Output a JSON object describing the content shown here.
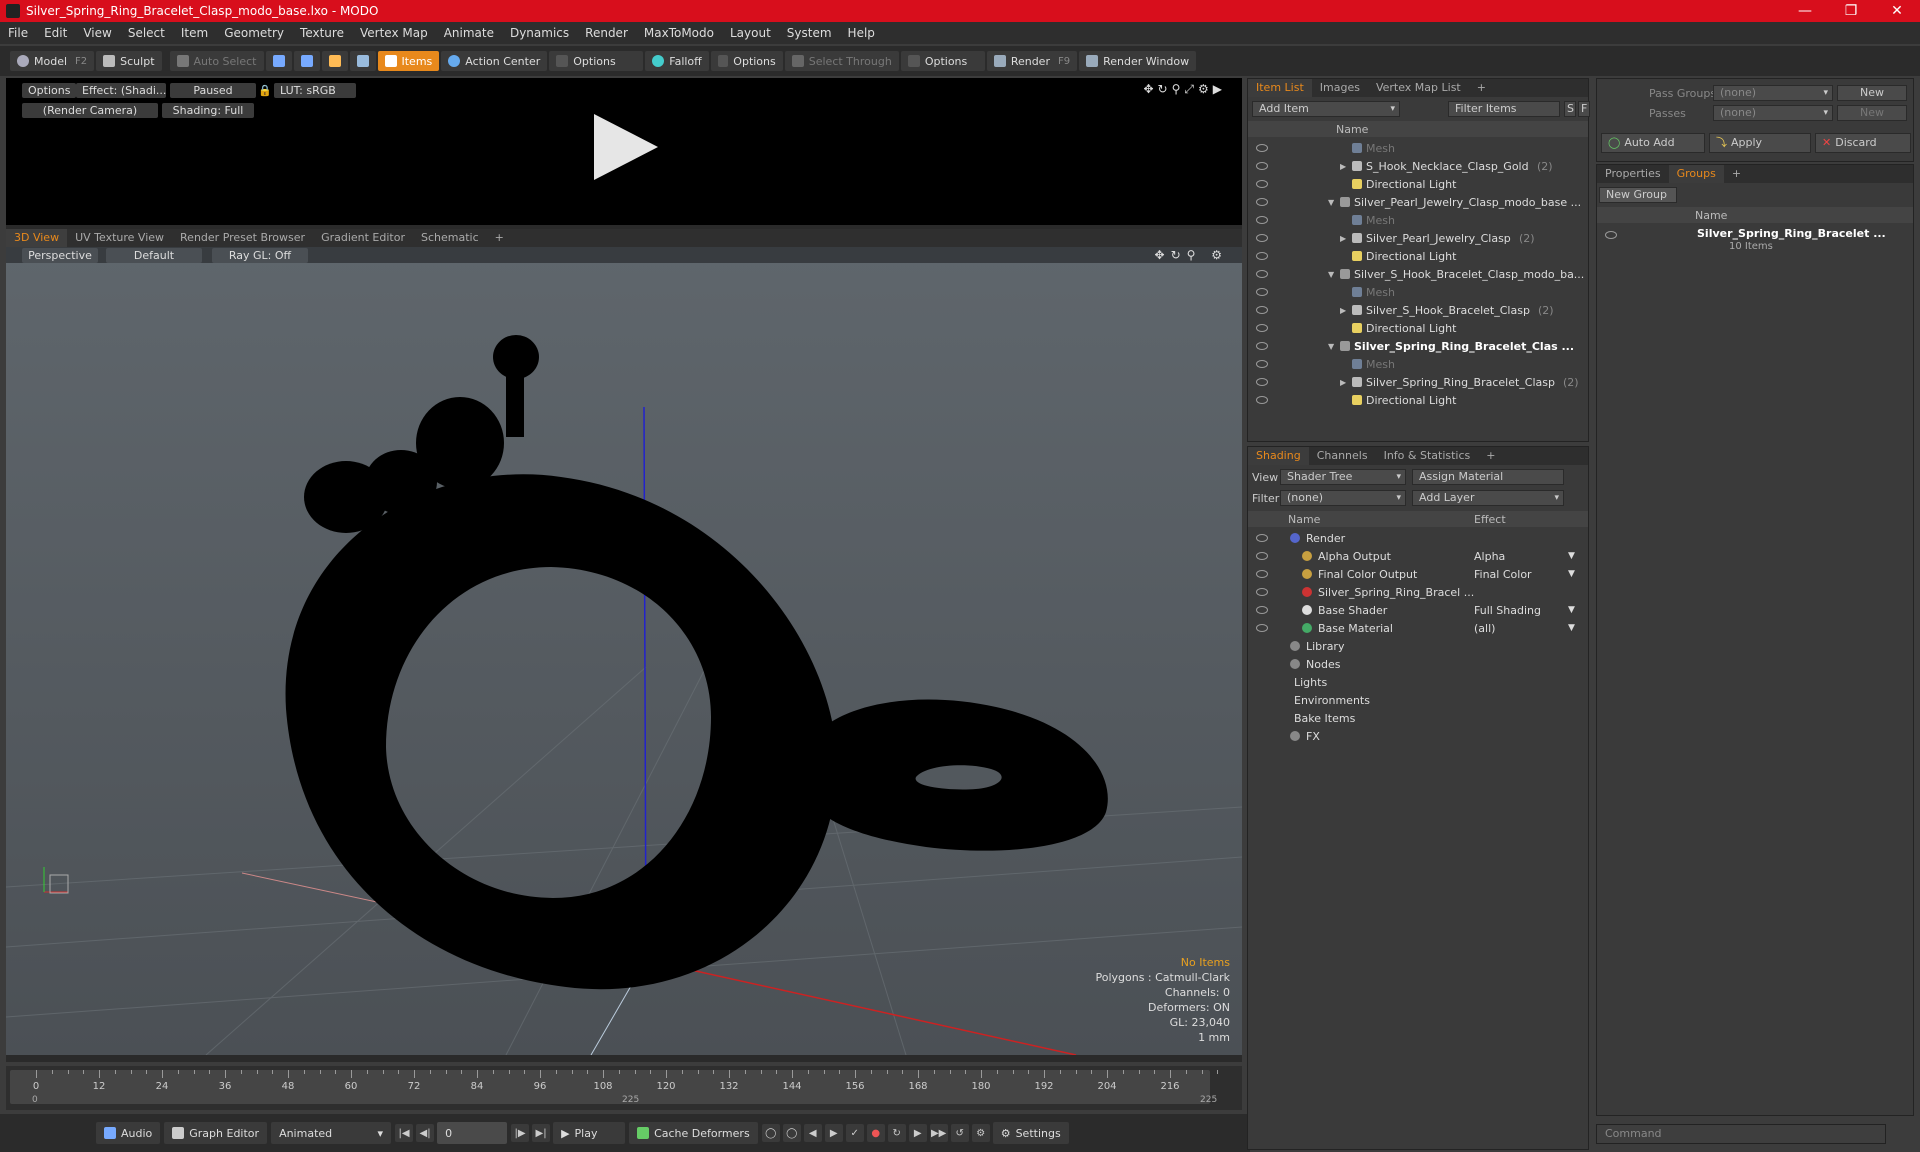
{
  "window": {
    "title": "Silver_Spring_Ring_Bracelet_Clasp_modo_base.lxo - MODO"
  },
  "menu": [
    "File",
    "Edit",
    "View",
    "Select",
    "Item",
    "Geometry",
    "Texture",
    "Vertex Map",
    "Animate",
    "Dynamics",
    "Render",
    "MaxToModo",
    "Layout",
    "System",
    "Help"
  ],
  "toolbar": {
    "model": "Model",
    "model_key": "F2",
    "sculpt": "Sculpt",
    "auto_select": "Auto Select",
    "items": "Items",
    "action_center": "Action Center",
    "options1": "Options",
    "falloff": "Falloff",
    "options2": "Options",
    "select_through": "Select Through",
    "options3": "Options",
    "render": "Render",
    "render_key": "F9",
    "render_window": "Render Window"
  },
  "preview": {
    "options": "Options",
    "effect": "Effect: (Shadi...",
    "paused": "Paused",
    "lut": "LUT: sRGB",
    "camera": "(Render Camera)",
    "shading": "Shading: Full"
  },
  "viewtabs": [
    "3D View",
    "UV Texture View",
    "Render Preset Browser",
    "Gradient Editor",
    "Schematic"
  ],
  "viewport": {
    "perspective": "Perspective",
    "default": "Default",
    "raygl": "Ray GL: Off"
  },
  "stats": {
    "items": "No Items",
    "polygons": "Polygons : Catmull-Clark",
    "channels": "Channels: 0",
    "deformers": "Deformers: ON",
    "gl": "GL: 23,040",
    "unit": "1 mm"
  },
  "timeline": {
    "labels": [
      "0",
      "12",
      "24",
      "36",
      "48",
      "60",
      "72",
      "84",
      "96",
      "108",
      "120",
      "132",
      "144",
      "156",
      "168",
      "180",
      "192",
      "204",
      "216"
    ],
    "start": "0",
    "mid": "225",
    "end": "225"
  },
  "bottombar": {
    "audio": "Audio",
    "graph_editor": "Graph Editor",
    "animated": "Animated",
    "frame": "0",
    "play": "Play",
    "cache": "Cache Deformers",
    "settings": "Settings"
  },
  "itemlist": {
    "tabs": [
      "Item List",
      "Images",
      "Vertex Map List"
    ],
    "add_item": "Add Item",
    "filter_items": "Filter Items",
    "col_name": "Name",
    "rows": [
      {
        "label": "Mesh",
        "indent": 2,
        "type": "mesh",
        "count": ""
      },
      {
        "label": "S_Hook_Necklace_Clasp_Gold",
        "indent": 2,
        "type": "group",
        "count": "(2)"
      },
      {
        "label": "Directional Light",
        "indent": 2,
        "type": "light",
        "count": ""
      },
      {
        "label": "Silver_Pearl_Jewelry_Clasp_modo_base ...",
        "indent": 1,
        "type": "scene",
        "count": ""
      },
      {
        "label": "Mesh",
        "indent": 2,
        "type": "mesh",
        "count": ""
      },
      {
        "label": "Silver_Pearl_Jewelry_Clasp",
        "indent": 2,
        "type": "group",
        "count": "(2)"
      },
      {
        "label": "Directional Light",
        "indent": 2,
        "type": "light",
        "count": ""
      },
      {
        "label": "Silver_S_Hook_Bracelet_Clasp_modo_ba...",
        "indent": 1,
        "type": "scene",
        "count": ""
      },
      {
        "label": "Mesh",
        "indent": 2,
        "type": "mesh",
        "count": ""
      },
      {
        "label": "Silver_S_Hook_Bracelet_Clasp",
        "indent": 2,
        "type": "group",
        "count": "(2)"
      },
      {
        "label": "Directional Light",
        "indent": 2,
        "type": "light",
        "count": ""
      },
      {
        "label": "Silver_Spring_Ring_Bracelet_Clas ...",
        "indent": 1,
        "type": "scene-bold",
        "count": ""
      },
      {
        "label": "Mesh",
        "indent": 2,
        "type": "mesh",
        "count": ""
      },
      {
        "label": "Silver_Spring_Ring_Bracelet_Clasp",
        "indent": 2,
        "type": "group",
        "count": "(2)"
      },
      {
        "label": "Directional Light",
        "indent": 2,
        "type": "light",
        "count": ""
      }
    ]
  },
  "shading": {
    "tabs": [
      "Shading",
      "Channels",
      "Info & Statistics"
    ],
    "view_label": "View",
    "view_value": "Shader Tree",
    "assign": "Assign Material",
    "filter_label": "Filter",
    "filter_value": "(none)",
    "add_layer": "Add Layer",
    "col_name": "Name",
    "col_effect": "Effect",
    "rows": [
      {
        "label": "Render",
        "effect": "",
        "indent": 1,
        "icon": "#5566cc",
        "eye": true
      },
      {
        "label": "Alpha Output",
        "effect": "Alpha",
        "indent": 2,
        "icon": "#c8a040",
        "eye": true
      },
      {
        "label": "Final Color Output",
        "effect": "Final Color",
        "indent": 2,
        "icon": "#c8a040",
        "eye": true
      },
      {
        "label": "Silver_Spring_Ring_Bracel ...",
        "effect": "",
        "indent": 2,
        "icon": "#cc3333",
        "eye": true
      },
      {
        "label": "Base Shader",
        "effect": "Full Shading",
        "indent": 2,
        "icon": "#dddddd",
        "eye": true
      },
      {
        "label": "Base Material",
        "effect": "(all)",
        "indent": 2,
        "icon": "#44aa66",
        "eye": true
      },
      {
        "label": "Library",
        "effect": "",
        "indent": 1,
        "icon": "#888888",
        "eye": false
      },
      {
        "label": "Nodes",
        "effect": "",
        "indent": 1,
        "icon": "#888888",
        "eye": false
      },
      {
        "label": "Lights",
        "effect": "",
        "indent": 0,
        "icon": "",
        "eye": false
      },
      {
        "label": "Environments",
        "effect": "",
        "indent": 0,
        "icon": "",
        "eye": false
      },
      {
        "label": "Bake Items",
        "effect": "",
        "indent": 0,
        "icon": "",
        "eye": false
      },
      {
        "label": "FX",
        "effect": "",
        "indent": 1,
        "icon": "#888888",
        "eye": false
      }
    ]
  },
  "passes": {
    "pass_groups": "Pass Groups",
    "passes": "Passes",
    "none1": "(none)",
    "none2": "(none)",
    "new1": "New",
    "new2": "New",
    "auto_add": "Auto Add",
    "apply": "Apply",
    "discard": "Discard"
  },
  "groups": {
    "tabs": [
      "Properties",
      "Groups"
    ],
    "new_group": "New Group",
    "col_name": "Name",
    "item": "Silver_Spring_Ring_Bracelet ...",
    "count": "10 Items"
  },
  "command": {
    "placeholder": "Command"
  }
}
